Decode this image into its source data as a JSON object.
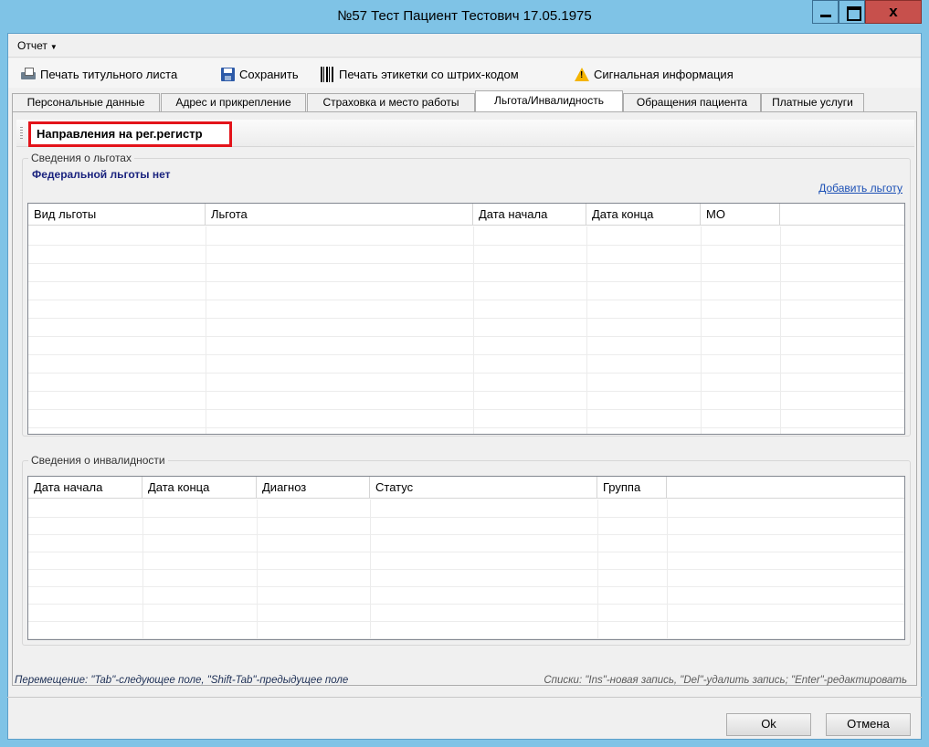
{
  "window": {
    "title": "№57 Тест Пациент Тестович 17.05.1975",
    "close_glyph": "x"
  },
  "menu": {
    "report": "Отчет"
  },
  "toolbar": {
    "print_title": "Печать титульного листа",
    "save": "Сохранить",
    "print_labels": "Печать этикетки со штрих-кодом",
    "signal_info": "Сигнальная информация"
  },
  "tabs": [
    {
      "label": "Персональные данные"
    },
    {
      "label": "Адрес и прикрепление"
    },
    {
      "label": "Страховка и место работы"
    },
    {
      "label": "Льгота/Инвалидность"
    },
    {
      "label": "Обращения пациента"
    },
    {
      "label": "Платные услуги"
    }
  ],
  "active_tab": "Льгота/Инвалидность",
  "panel": {
    "reg_button": "Направления на рег.регистр",
    "benefits": {
      "group_label": "Сведения о льготах",
      "federal_text": "Федеральной льготы нет",
      "add_link": "Добавить льготу",
      "columns": [
        "Вид льготы",
        "Льгота",
        "Дата начала",
        "Дата конца",
        "МО"
      ]
    },
    "disability": {
      "group_label": "Сведения о инвалидности",
      "columns": [
        "Дата начала",
        "Дата конца",
        "Диагноз",
        "Статус",
        "Группа"
      ]
    }
  },
  "status": {
    "left": "Перемещение: \"Tab\"-следующее поле, \"Shift-Tab\"-предыдущее поле",
    "right": "Списки: \"Ins\"-новая запись, \"Del\"-удалить запись; \"Enter\"-редактировать"
  },
  "buttons": {
    "ok": "Ok",
    "cancel": "Отмена"
  },
  "colors": {
    "highlight_border": "#e3131a",
    "window_frame": "#7fc3e6",
    "close_button": "#c7504c",
    "link": "#1a4fb5"
  }
}
